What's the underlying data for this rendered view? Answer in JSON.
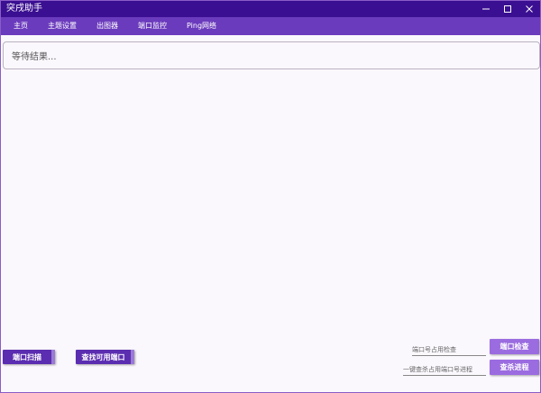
{
  "window": {
    "title": "突戌助手"
  },
  "menu": {
    "items": [
      {
        "label": "主页"
      },
      {
        "label": "主题设置"
      },
      {
        "label": "出图器"
      },
      {
        "label": "端口监控"
      },
      {
        "label": "Ping网络"
      }
    ]
  },
  "result": {
    "text": "等待结果..."
  },
  "bottom": {
    "port_scan_label": "端口扫描",
    "find_free_port_label": "查找可用端口",
    "port_check_placeholder": "端口号占用检查",
    "port_check_label": "端口检查",
    "find_process_placeholder": "一键查杀占用端口号进程",
    "find_process_label": "查杀进程"
  },
  "colors": {
    "titlebar": "#3a0f91",
    "menubar": "#6b3bbd",
    "button_dark": "#5b2db0",
    "button_light": "#9b6ce0"
  }
}
